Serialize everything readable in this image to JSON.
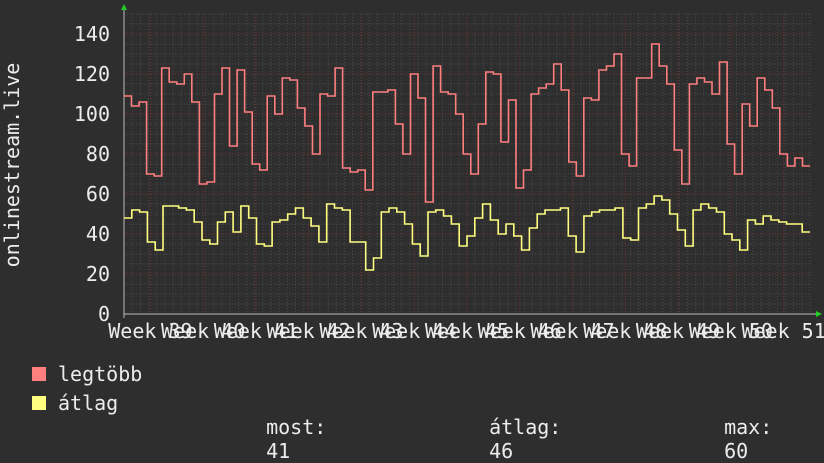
{
  "chart_data": {
    "type": "line",
    "ylabel": "onlinestream.live",
    "ylim": [
      0,
      150
    ],
    "yticks": [
      0,
      20,
      40,
      60,
      80,
      100,
      120,
      140
    ],
    "xticks": [
      "Week 39",
      "Week 40",
      "Week 41",
      "Week 42",
      "Week 43",
      "Week 44",
      "Week 45",
      "Week 46",
      "Week 47",
      "Week 48",
      "Week 49",
      "Week 50",
      "Week 51"
    ],
    "grid": true,
    "series": [
      {
        "name": "legtöbb",
        "color": "#ff7f7f",
        "values": [
          109,
          104,
          106,
          70,
          69,
          123,
          116,
          115,
          120,
          106,
          65,
          66,
          110,
          123,
          84,
          122,
          101,
          75,
          72,
          109,
          100,
          118,
          117,
          103,
          94,
          80,
          110,
          109,
          123,
          73,
          71,
          72,
          62,
          111,
          111,
          112,
          95,
          80,
          120,
          108,
          56,
          124,
          111,
          110,
          100,
          80,
          70,
          95,
          121,
          120,
          86,
          107,
          63,
          72,
          110,
          113,
          115,
          125,
          112,
          76,
          69,
          108,
          107,
          122,
          124,
          130,
          80,
          74,
          118,
          118,
          135,
          124,
          115,
          82,
          65,
          115,
          118,
          116,
          110,
          126,
          85,
          70,
          105,
          94,
          118,
          112,
          103,
          80,
          74,
          78,
          74
        ]
      },
      {
        "name": "átlag",
        "color": "#ffff80",
        "values": [
          48,
          52,
          51,
          36,
          32,
          54,
          54,
          53,
          52,
          46,
          37,
          35,
          46,
          51,
          41,
          54,
          48,
          35,
          34,
          46,
          47,
          50,
          53,
          48,
          44,
          36,
          55,
          53,
          52,
          36,
          36,
          22,
          28,
          51,
          53,
          51,
          45,
          35,
          29,
          51,
          52,
          49,
          45,
          34,
          39,
          48,
          55,
          47,
          40,
          45,
          39,
          32,
          43,
          50,
          52,
          52,
          53,
          39,
          31,
          49,
          51,
          52,
          52,
          53,
          38,
          37,
          53,
          55,
          59,
          57,
          50,
          42,
          34,
          52,
          55,
          53,
          51,
          40,
          37,
          32,
          47,
          45,
          49,
          47,
          46,
          45,
          45,
          41
        ]
      }
    ]
  },
  "legend": [
    {
      "label": "legtöbb",
      "color": "#ff7f7f"
    },
    {
      "label": "átlag",
      "color": "#ffff80"
    }
  ],
  "stats": {
    "current_label": "most:",
    "current_value": "41",
    "average_label": "átlag:",
    "average_value": "46",
    "max_label": "max:",
    "max_value": "60"
  }
}
